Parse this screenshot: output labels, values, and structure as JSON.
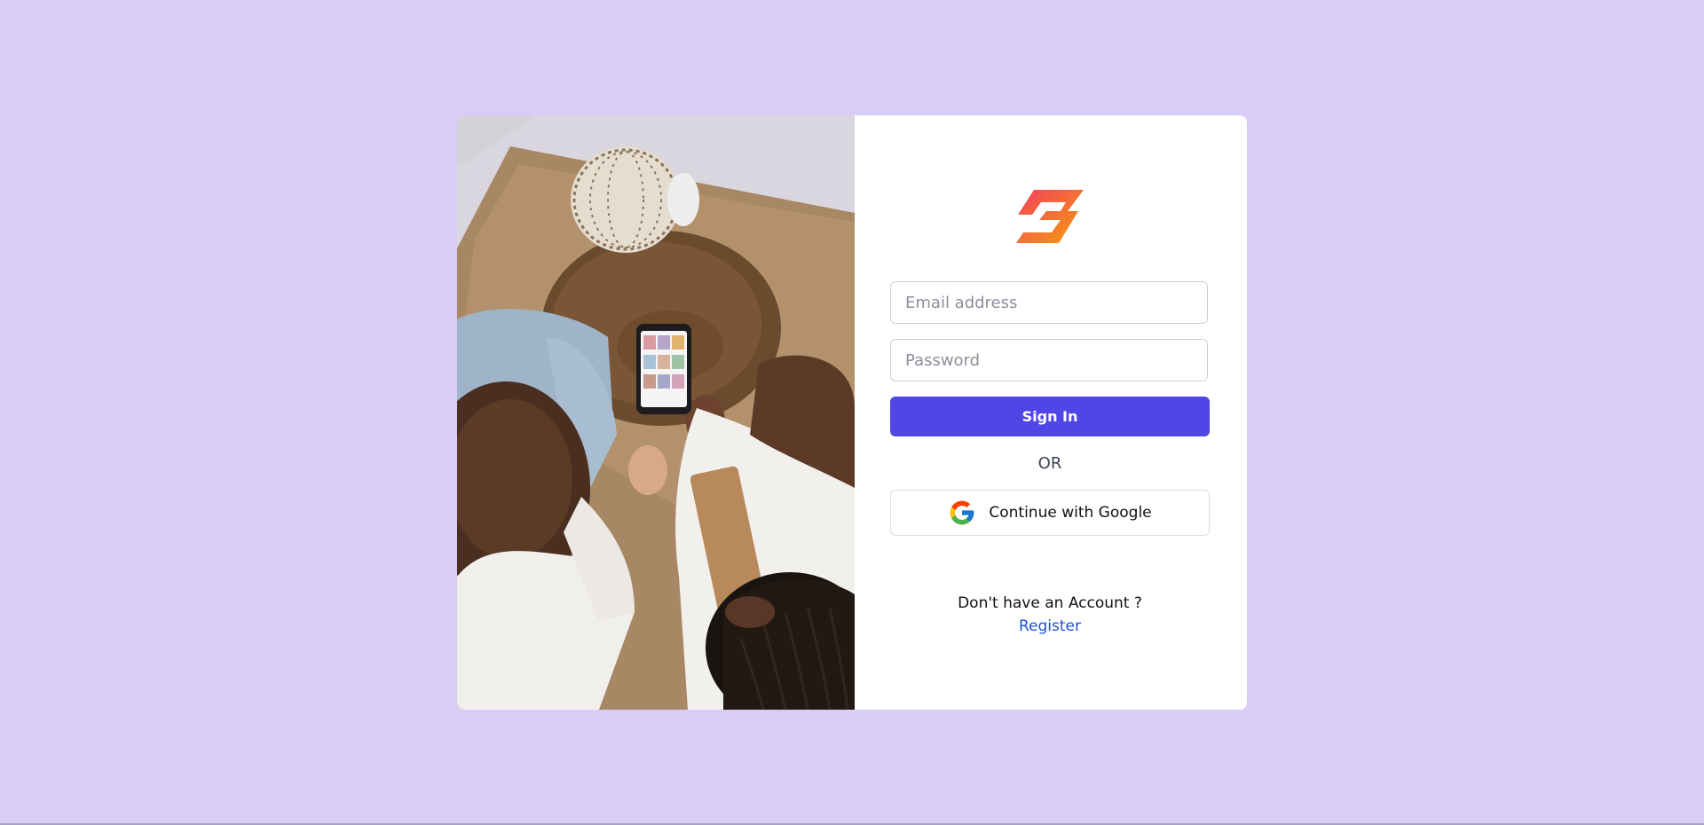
{
  "colors": {
    "background": "#d9cdf8",
    "card": "#ffffff",
    "primary": "#4f46e5",
    "link": "#1d4ed8",
    "logo_gradient_start": "#f43f5e",
    "logo_gradient_end": "#f59e0b"
  },
  "hero": {
    "image_alt": "Two people looking at a smartphone photo gallery beside a wooden table",
    "logo_icon": "brand-logo-icon"
  },
  "login": {
    "email_placeholder": "Email address",
    "password_placeholder": "Password",
    "sign_in_label": "Sign In",
    "divider_text": "OR",
    "google_label": "Continue with Google",
    "google_icon": "google-icon",
    "no_account_text": "Don't have an Account ?",
    "register_label": "Register"
  }
}
